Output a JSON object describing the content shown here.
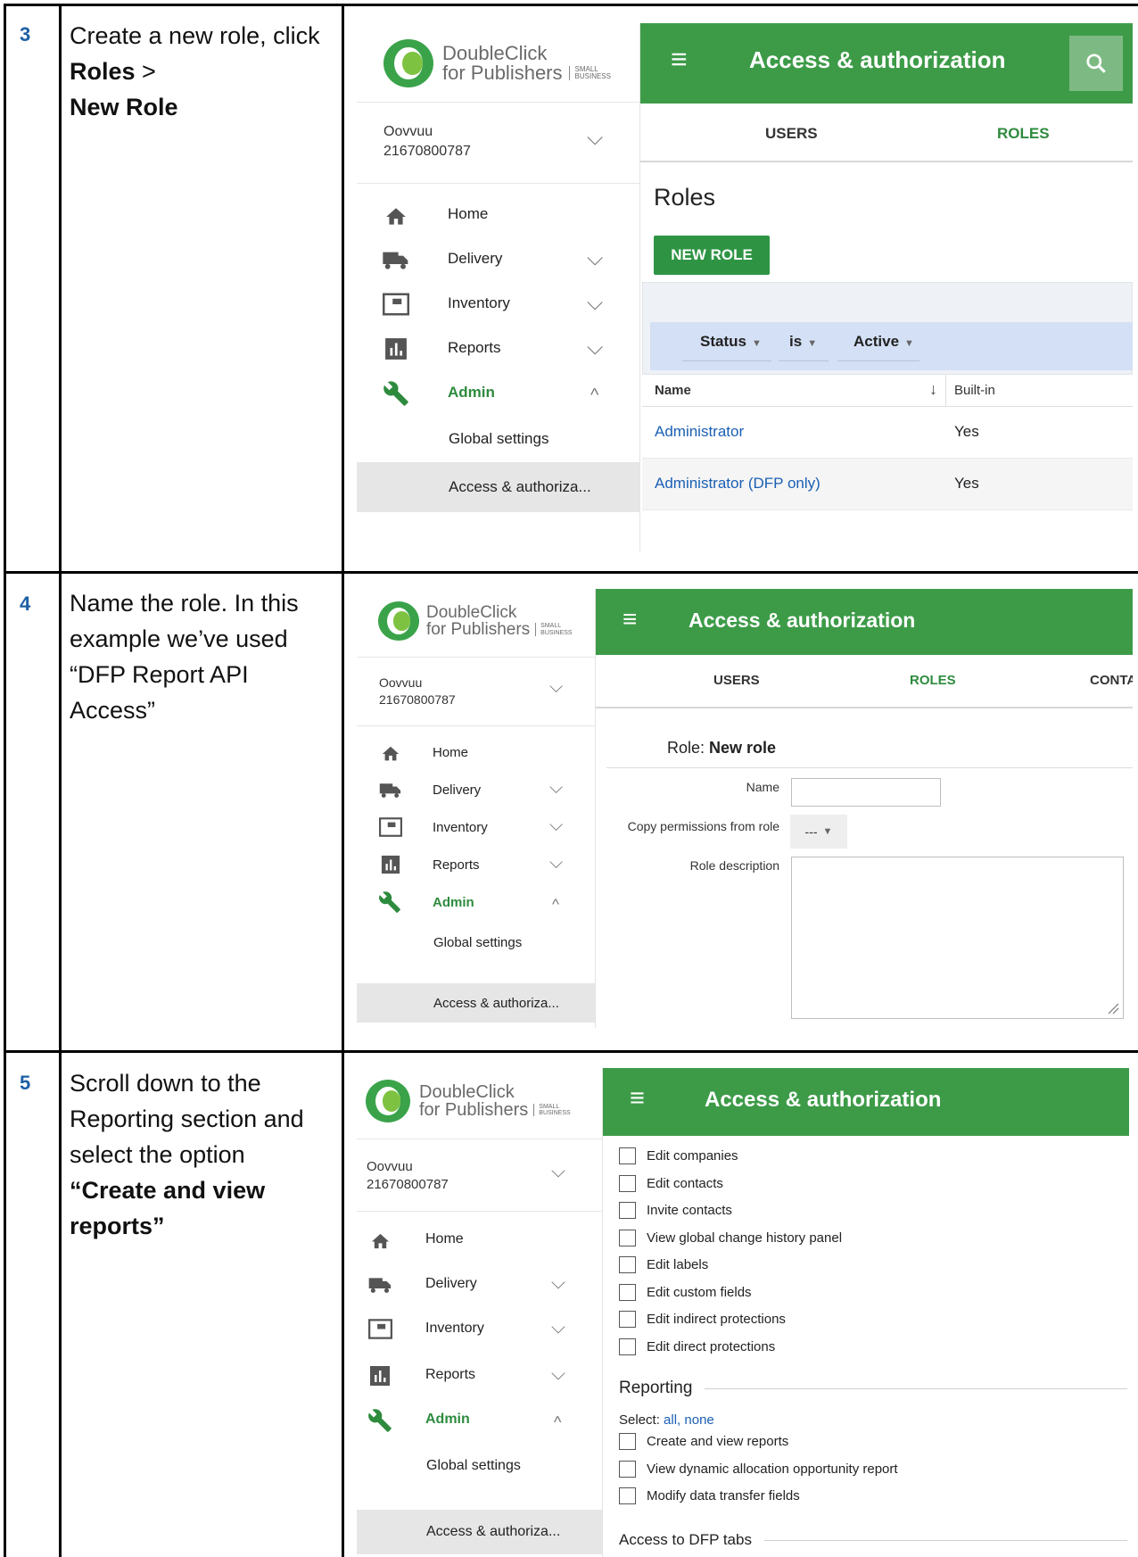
{
  "steps": [
    {
      "number": "3",
      "instruction_pre": "Create a new role, click ",
      "instruction_bold1": "Roles",
      "instruction_mid": " > ",
      "instruction_bold2": "New Role",
      "ui": {
        "logo_line1": "DoubleClick",
        "logo_line2": "for Publishers",
        "logo_small1": "SMALL",
        "logo_small2": "BUSINESS",
        "account_name": "Oovvuu",
        "account_id": "21670800787",
        "nav": [
          "Home",
          "Delivery",
          "Inventory",
          "Reports",
          "Admin"
        ],
        "nav_sub": [
          "Global settings",
          "Access & authoriza..."
        ],
        "header_title": "Access & authorization",
        "tabs": [
          "USERS",
          "ROLES"
        ],
        "page_heading": "Roles",
        "new_role_button": "NEW ROLE",
        "filter": [
          "Status",
          "is",
          "Active"
        ],
        "table_headers": [
          "Name",
          "Built-in"
        ],
        "rows": [
          {
            "name": "Administrator",
            "builtin": "Yes"
          },
          {
            "name": "Administrator (DFP only)",
            "builtin": "Yes"
          }
        ]
      }
    },
    {
      "number": "4",
      "instruction": "Name the role. In this example we’ve used “DFP Report API Access”",
      "ui": {
        "logo_line1": "DoubleClick",
        "logo_line2": "for Publishers",
        "logo_small1": "SMALL",
        "logo_small2": "BUSINESS",
        "account_name": "Oovvuu",
        "account_id": "21670800787",
        "nav": [
          "Home",
          "Delivery",
          "Inventory",
          "Reports",
          "Admin"
        ],
        "nav_sub": [
          "Global settings",
          "Access & authoriza..."
        ],
        "header_title": "Access & authorization",
        "tabs": [
          "USERS",
          "ROLES",
          "CONTA"
        ],
        "role_label": "Role: ",
        "role_value": "New role",
        "name_label": "Name",
        "copy_label": "Copy permissions from role",
        "copy_value": "---",
        "desc_label": "Role description"
      }
    },
    {
      "number": "5",
      "instruction_pre": "Scroll down to the Reporting section and select the option ",
      "instruction_bold": "“Create and view reports”",
      "ui": {
        "logo_line1": "DoubleClick",
        "logo_line2": "for Publishers",
        "logo_small1": "SMALL",
        "logo_small2": "BUSINESS",
        "account_name": "Oovvuu",
        "account_id": "21670800787",
        "nav": [
          "Home",
          "Delivery",
          "Inventory",
          "Reports",
          "Admin"
        ],
        "nav_sub": [
          "Global settings",
          "Access & authoriza..."
        ],
        "header_title": "Access & authorization",
        "perms_top": [
          "Edit companies",
          "Edit contacts",
          "Invite contacts",
          "View global change history panel",
          "Edit labels",
          "Edit custom fields",
          "Edit indirect protections",
          "Edit direct protections"
        ],
        "reporting_title": "Reporting",
        "select_label": "Select: ",
        "select_all": "all",
        "select_sep": ", ",
        "select_none": "none",
        "perms_reporting": [
          "Create and view reports",
          "View dynamic allocation opportunity report",
          "Modify data transfer fields"
        ],
        "next_section": "Access to DFP tabs"
      }
    }
  ],
  "colors": {
    "accent_green": "#3d9b48",
    "link_blue": "#1a5fb4",
    "step_number": "#1c5fa5"
  }
}
